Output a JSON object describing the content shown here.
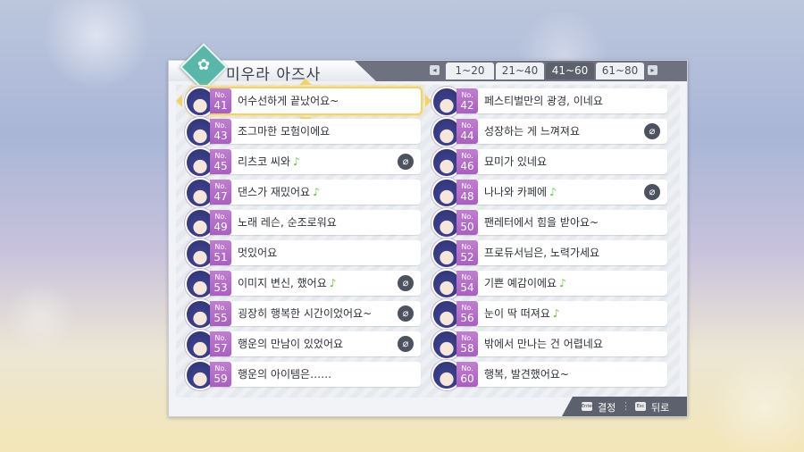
{
  "title": "미우라 아즈사",
  "tabs": {
    "left_key": "◂",
    "right_key": "▸",
    "items": [
      {
        "label": "1~20",
        "active": false
      },
      {
        "label": "21~40",
        "active": false
      },
      {
        "label": "41~60",
        "active": true
      },
      {
        "label": "61~80",
        "active": false
      }
    ]
  },
  "no_label": "No.",
  "items": [
    {
      "num": "41",
      "text": "어수선하게 끝났어요~",
      "note": "",
      "badge": false,
      "selected": true
    },
    {
      "num": "42",
      "text": "페스티벌만의 광경, 이네요",
      "note": "",
      "badge": false
    },
    {
      "num": "43",
      "text": "조그마한 모험이에요",
      "note": "",
      "badge": false
    },
    {
      "num": "44",
      "text": "성장하는 게 느껴져요",
      "note": "",
      "badge": true
    },
    {
      "num": "45",
      "text": "리츠코 씨와",
      "note": "♪",
      "badge": true
    },
    {
      "num": "46",
      "text": "묘미가 있네요",
      "note": "",
      "badge": false
    },
    {
      "num": "47",
      "text": "댄스가 재밌어요",
      "note": "♪",
      "badge": false
    },
    {
      "num": "48",
      "text": "나나와 카페에",
      "note": "♪",
      "badge": true
    },
    {
      "num": "49",
      "text": "노래 레슨, 순조로워요",
      "note": "",
      "badge": false
    },
    {
      "num": "50",
      "text": "팬레터에서 힘을 받아요~",
      "note": "",
      "badge": false
    },
    {
      "num": "51",
      "text": "멋있어요",
      "note": "",
      "badge": false
    },
    {
      "num": "52",
      "text": "프로듀서님은, 노력가세요",
      "note": "",
      "badge": false
    },
    {
      "num": "53",
      "text": "이미지 변신, 했어요",
      "note": "♪",
      "badge": true
    },
    {
      "num": "54",
      "text": "기쁜 예감이에요",
      "note": "♪",
      "badge": false
    },
    {
      "num": "55",
      "text": "굉장히 행복한 시간이었어요~",
      "note": "",
      "badge": true
    },
    {
      "num": "56",
      "text": "눈이 딱 떠져요",
      "note": "♪",
      "badge": false
    },
    {
      "num": "57",
      "text": "행운의 만남이 있었어요",
      "note": "",
      "badge": true
    },
    {
      "num": "58",
      "text": "밖에서 만나는 건 어렵네요",
      "note": "",
      "badge": false
    },
    {
      "num": "59",
      "text": "행운의 아이템은……",
      "note": "",
      "badge": false
    },
    {
      "num": "60",
      "text": "행복, 발견했어요~",
      "note": "",
      "badge": false
    }
  ],
  "footer": {
    "confirm_key": "Enter",
    "confirm_label": "결정",
    "back_key": "Esc",
    "back_label": "뒤로"
  },
  "colors": {
    "accent_teal": "#5bb6aa",
    "number_purple": "#b56fc8",
    "note_green": "#6cc04a",
    "selection_gold": "#f2d36a",
    "header_dark": "#5d616d"
  },
  "icons": {
    "emblem": "character-emblem-icon",
    "badge": "clip-icon",
    "avatar": "character-avatar-icon"
  }
}
